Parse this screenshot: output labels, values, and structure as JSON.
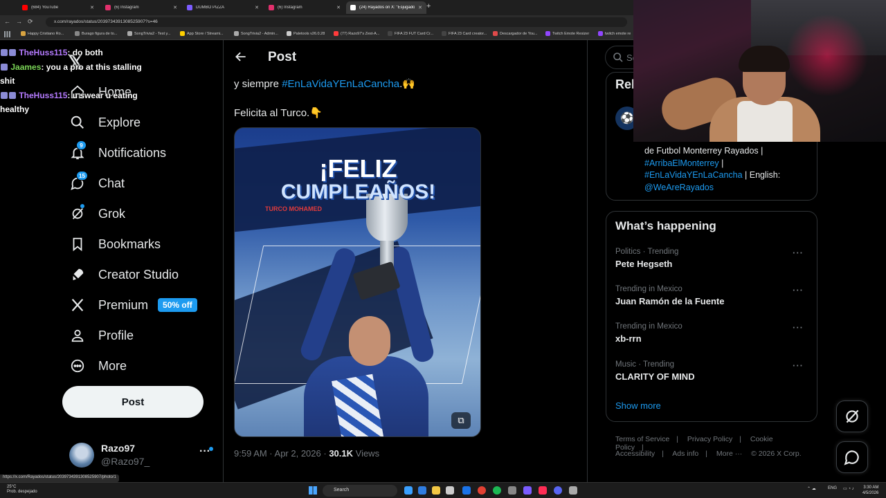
{
  "browser": {
    "tabs": [
      {
        "label": "(684) YouTube",
        "color": "#ff0000"
      },
      {
        "label": "(6) Instagram",
        "color": "#e1306c"
      },
      {
        "label": "DUMBO PIZZA",
        "color": "#7c5cff"
      },
      {
        "label": "(6) Instagram",
        "color": "#e1306c"
      },
      {
        "label": "(24) Rayados on X: \"Esjugador",
        "color": "#ffffff"
      }
    ],
    "url": "x.com/rayados/status/2039734391308525907?s=46",
    "bookmarks": [
      "Happy Cristiano Ro...",
      "Burago figura de to...",
      "SongTrivia2 - Test y...",
      "App Store / Streami...",
      "SongTrivia2 - Admin...",
      "Paletools v26.0.28",
      "(77) Razo97's Zest-A...",
      "FIFA 23 FUT Card Cr...",
      "FIFA 23 Card creator...",
      "Descargador de You...",
      "Twitch Emote Resizer",
      "twitch emote re"
    ],
    "status_url": "https://x.com/Rayados/status/2039734391308525907/photo/1"
  },
  "chat": [
    {
      "user": "TheHuss115",
      "message": ": do both",
      "color": "purple"
    },
    {
      "user": "Jaames",
      "message": ": you a pro at this stalling shit",
      "color": "green"
    },
    {
      "user": "TheHuss115",
      "message": ": u swear u eating healthy",
      "color": "purple"
    }
  ],
  "nav": {
    "items": [
      {
        "label": "Home",
        "icon": "home-icon"
      },
      {
        "label": "Explore",
        "icon": "search-icon"
      },
      {
        "label": "Notifications",
        "icon": "bell-icon",
        "badge": "9"
      },
      {
        "label": "Chat",
        "icon": "chat-icon",
        "badge": "15"
      },
      {
        "label": "Grok",
        "icon": "grok-icon"
      },
      {
        "label": "Bookmarks",
        "icon": "bookmark-icon"
      },
      {
        "label": "Creator Studio",
        "icon": "rocket-icon"
      },
      {
        "label": "Premium",
        "icon": "x-icon",
        "offer": "50% off"
      },
      {
        "label": "Profile",
        "icon": "person-icon"
      },
      {
        "label": "More",
        "icon": "more-icon"
      }
    ],
    "post_button": "Post",
    "account": {
      "name": "Razo97",
      "handle": "@Razo97_"
    }
  },
  "main": {
    "header_title": "Post",
    "tweet_line1_prefix": "y siempre ",
    "tweet_hashtag": "#EnLaVidaYEnLaCancha",
    "tweet_line1_suffix": ".🙌",
    "tweet_line2": "Felicita al Turco.👇",
    "image_text": {
      "line1": "¡FELIZ",
      "line2": "CUMPLEAÑOS!",
      "name": "TURCO MOHAMED"
    },
    "timestamp": "9:59 AM · Apr 2, 2026 · ",
    "views_count": "30.1K",
    "views_label": " Views"
  },
  "right": {
    "search_placeholder": "Se",
    "relevant_title": "Rel",
    "bio": {
      "line1": "de Futbol Monterrey Rayados |",
      "hashtag1": "#ArribaElMonterrey",
      "sep1": " |",
      "hashtag2": "#EnLaVidaYEnLaCancha",
      "sep2": " | English:",
      "mention": "@WeAreRayados"
    },
    "whats_happening_title": "What’s happening",
    "trends": [
      {
        "context": "Politics · Trending",
        "name": "Pete Hegseth"
      },
      {
        "context": "Trending in Mexico",
        "name": "Juan Ramón de la Fuente"
      },
      {
        "context": "Trending in Mexico",
        "name": "xb-rrn"
      },
      {
        "context": "Music · Trending",
        "name": "CLARITY OF MIND"
      }
    ],
    "show_more": "Show more",
    "footer_row1": [
      "Terms of Service",
      "Privacy Policy",
      "Cookie Policy"
    ],
    "footer_row2": [
      "Accessibility",
      "Ads info",
      "More ···",
      "© 2026 X Corp."
    ]
  },
  "taskbar": {
    "weather_temp": "25°C",
    "weather_desc": "Prob. despejado",
    "search": "Search",
    "lang": "ENG",
    "time": "3:30 AM",
    "date": "4/5/2026"
  },
  "colors": {
    "accent": "#1d9bf0",
    "background": "#000000",
    "border": "#2f3336",
    "muted": "#71767b"
  }
}
